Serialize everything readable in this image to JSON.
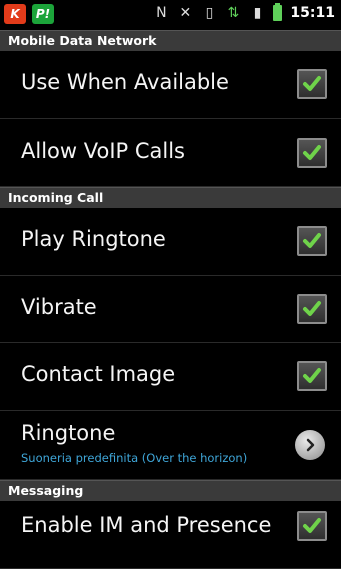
{
  "status_bar": {
    "time": "15:11",
    "icons": [
      "red-app-icon",
      "green-app-icon",
      "nfc-icon",
      "mute-icon",
      "vibrate-icon",
      "data-arrows-icon",
      "signal-icon",
      "battery-icon"
    ],
    "app_badge_red": "K",
    "app_badge_green": "P!"
  },
  "sections": {
    "mobile_data": {
      "title": "Mobile Data Network",
      "items": [
        {
          "label": "Use When Available",
          "checked": true
        },
        {
          "label": "Allow VoIP Calls",
          "checked": true
        }
      ]
    },
    "incoming_call": {
      "title": "Incoming Call",
      "items": [
        {
          "label": "Play Ringtone",
          "checked": true
        },
        {
          "label": "Vibrate",
          "checked": true
        },
        {
          "label": "Contact Image",
          "checked": true
        }
      ],
      "ringtone": {
        "label": "Ringtone",
        "value": "Suoneria predefinita (Over the horizon)"
      }
    },
    "messaging": {
      "title": "Messaging",
      "items": [
        {
          "label": "Enable IM and Presence",
          "checked": true
        }
      ]
    }
  },
  "colors": {
    "section_bg": "#3a3a3a",
    "check_green": "#6fd34a",
    "sublabel_blue": "#3fa6d8"
  }
}
